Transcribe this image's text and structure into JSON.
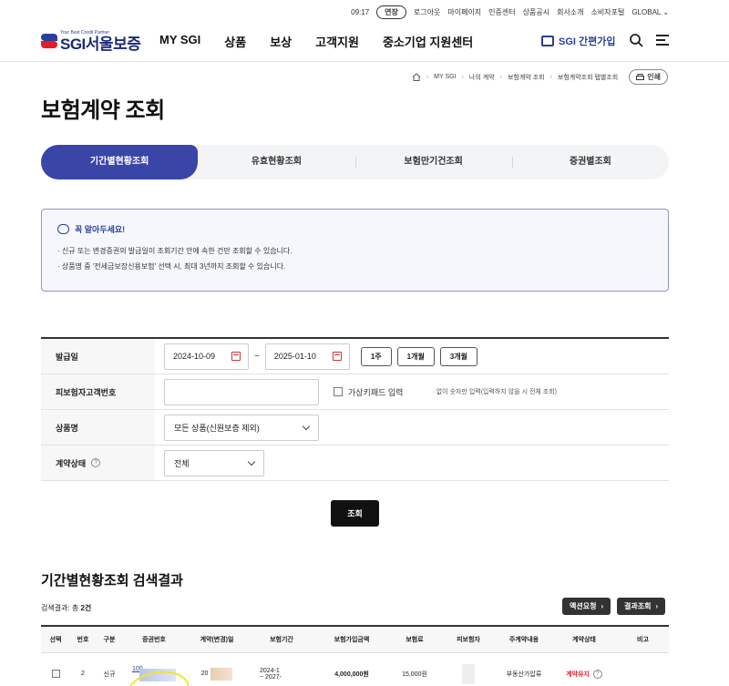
{
  "util_bar": {
    "time": "09:17",
    "extend_label": "연장",
    "links": [
      "로그아웃",
      "마이페이지",
      "인증센터",
      "상품공시",
      "회사소개",
      "소비자포털"
    ],
    "global_label": "GLOBAL"
  },
  "header": {
    "logo_tagline": "Your Best Credit Partner",
    "logo_text": "SGI서울보증",
    "nav": [
      "MY SGI",
      "상품",
      "보상",
      "고객지원",
      "중소기업 지원센터"
    ],
    "easy_join_label": "SGI 간편가입"
  },
  "breadcrumb": {
    "items": [
      "MY SGI",
      "나의 계약",
      "보험계약 조회",
      "보험계약조회 탭별조회"
    ],
    "print_label": "인쇄"
  },
  "page_title": "보험계약 조회",
  "tabs": [
    {
      "label": "기간별현황조회",
      "active": true
    },
    {
      "label": "유효현황조회",
      "active": false
    },
    {
      "label": "보험만기건조회",
      "active": false
    },
    {
      "label": "증권별조회",
      "active": false
    }
  ],
  "notice": {
    "title": "꼭 알아두세요!",
    "lines": [
      "· 신규 또는 변경증권의 발급일이 조회기간 안에 속한 건만 조회할 수 있습니다.",
      "· 상품명 중 '전세금보장신용보험' 선택 시, 최대 3년까지 조회할 수 있습니다."
    ]
  },
  "form": {
    "issue_date": {
      "label": "발급일",
      "start": "2024-10-09",
      "end": "2025-01-10",
      "tilde": "~",
      "period_buttons": [
        "1주",
        "1개월",
        "3개월"
      ]
    },
    "insured_id": {
      "label": "피보험자고객번호",
      "virtual_keypad_label": "가상키패드 입력",
      "hint": "· 없이 숫자만 입력(입력하지 않을 시 전체 조회)"
    },
    "product": {
      "label": "상품명",
      "selected": "모든 상품(신원보증 제외)"
    },
    "contract_status": {
      "label": "계약상태",
      "selected": "전체"
    }
  },
  "search_button": "조회",
  "results": {
    "title": "기간별현황조회 검색결과",
    "count_prefix": "검색결과: 총 ",
    "count_value": "2건",
    "buttons": [
      "액션요청",
      "결과조회"
    ],
    "columns": [
      "선택",
      "번호",
      "구분",
      "증권번호",
      "계약(변경)일",
      "보험기간",
      "보험가입금액",
      "보험료",
      "피보험자",
      "주계약내용",
      "계약상태",
      "비고"
    ],
    "rows": [
      {
        "no": "2",
        "type": "신규",
        "policy_no": "100",
        "contract_date": "20",
        "period_start": "2024-1",
        "period_end": "~ 2027-",
        "insured_amount": "4,000,000원",
        "premium": "15,000원",
        "insured": "",
        "main_contract": "부동산가압류",
        "status": "계약유지",
        "note": ""
      }
    ]
  },
  "colors": {
    "brand_navy": "#2a3f9b",
    "brand_red": "#e21c2a",
    "active_tab": "#3a45a8",
    "status_red": "#e0252c",
    "annotation_yellow": "#f3e33a"
  }
}
